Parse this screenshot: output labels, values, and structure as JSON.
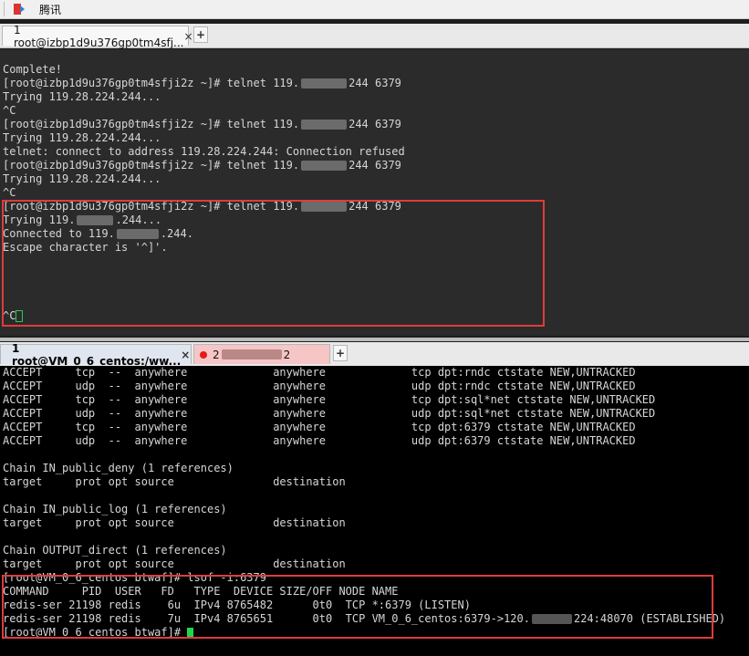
{
  "app": {
    "title": "腾讯",
    "colors": {
      "accent_red": "#e03b3b",
      "cursor_green": "#20d64c"
    }
  },
  "tabs_top": [
    {
      "label": "1 root@izbp1d9u376gp0tm4sfj...",
      "status_color": "#18b13a",
      "close": "×"
    }
  ],
  "tabs_bottom": [
    {
      "label": "1 root@VM_0_6_centos:/ww...",
      "status_color": "#18b13a",
      "close": "×"
    },
    {
      "label": "2",
      "status_color": "#e21b1b",
      "label_suffix": "2"
    }
  ],
  "plus_symbol": "+",
  "terminal1": {
    "lines": [
      "",
      "Complete!",
      "[root@izbp1d9u376gp0tm4sfji2z ~]# telnet 119.",
      "Trying 119.28.224.244...",
      "^C",
      "[root@izbp1d9u376gp0tm4sfji2z ~]# telnet 119.",
      "Trying 119.28.224.244...",
      "telnet: connect to address 119.28.224.244: Connection refused",
      "[root@izbp1d9u376gp0tm4sfji2z ~]# telnet 119.",
      "Trying 119.28.224.244...",
      "^C",
      "[root@izbp1d9u376gp0tm4sfji2z ~]# telnet 119.",
      "Trying 119.",
      "Connected to 119.",
      "Escape character is '^]'.",
      "",
      "",
      "",
      "",
      "^C"
    ],
    "masked_suffixes": {
      "2": "244 6379",
      "5": "244 6379",
      "8": "244 6379",
      "11": "244 6379",
      "12": ".244...",
      "13": ".244."
    }
  },
  "terminal2": {
    "lines": [
      "ACCEPT     tcp  --  anywhere             anywhere             tcp dpt:rndc ctstate NEW,UNTRACKED",
      "ACCEPT     udp  --  anywhere             anywhere             udp dpt:rndc ctstate NEW,UNTRACKED",
      "ACCEPT     tcp  --  anywhere             anywhere             tcp dpt:sql*net ctstate NEW,UNTRACKED",
      "ACCEPT     udp  --  anywhere             anywhere             udp dpt:sql*net ctstate NEW,UNTRACKED",
      "ACCEPT     tcp  --  anywhere             anywhere             tcp dpt:6379 ctstate NEW,UNTRACKED",
      "ACCEPT     udp  --  anywhere             anywhere             udp dpt:6379 ctstate NEW,UNTRACKED",
      "",
      "Chain IN_public_deny (1 references)",
      "target     prot opt source               destination",
      "",
      "Chain IN_public_log (1 references)",
      "target     prot opt source               destination",
      "",
      "Chain OUTPUT_direct (1 references)",
      "target     prot opt source               destination",
      "[root@VM_0_6_centos btwaf]# lsof -i:6379",
      "COMMAND     PID  USER   FD   TYPE  DEVICE SIZE/OFF NODE NAME",
      "redis-ser 21198 redis    6u  IPv4 8765482      0t0  TCP *:6379 (LISTEN)",
      "redis-ser 21198 redis    7u  IPv4 8765651      0t0  TCP VM_0_6_centos:6379->120.",
      "[root@VM_0_6_centos btwaf]# "
    ],
    "masked_suffixes": {
      "18": "224:48070 (ESTABLISHED)"
    }
  }
}
